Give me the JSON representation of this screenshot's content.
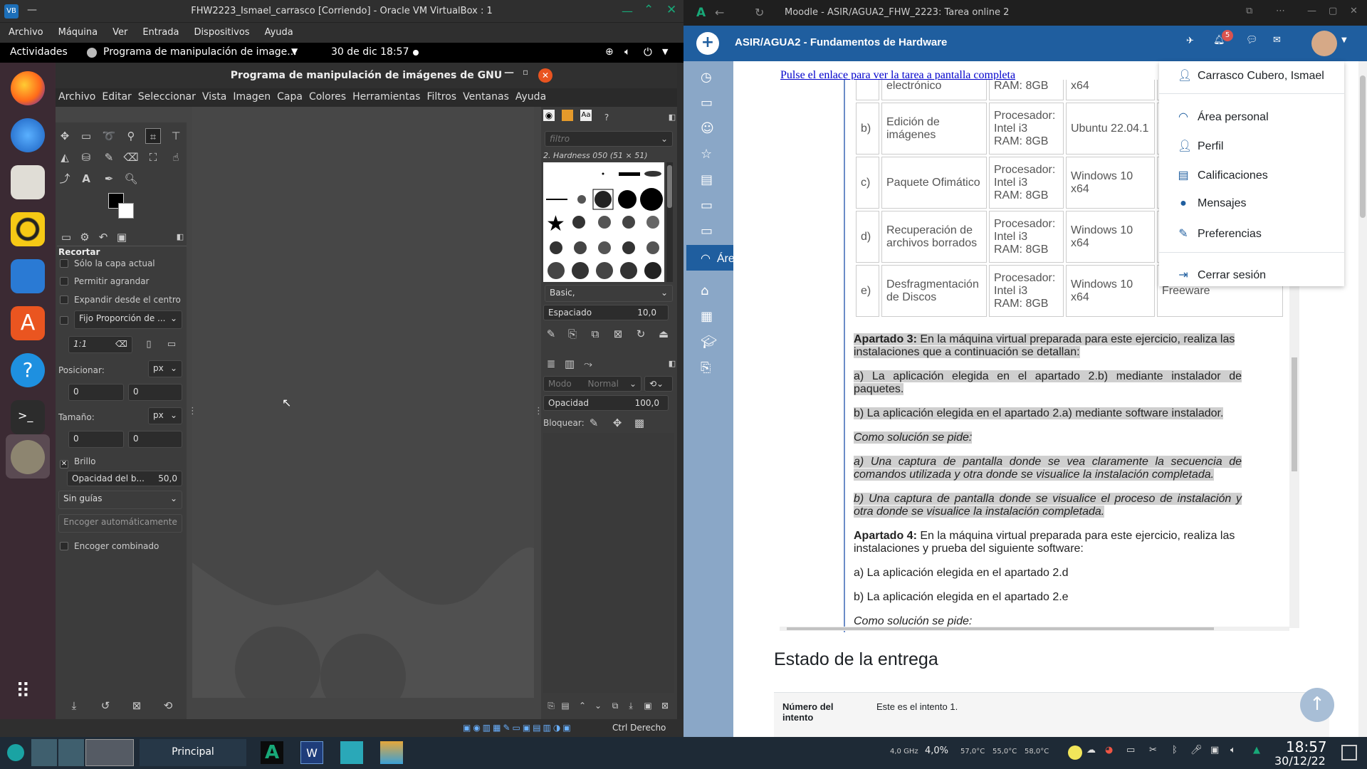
{
  "vbox": {
    "title": "FHW2223_Ismael_carrasco [Corriendo] - Oracle VM VirtualBox : 1",
    "menu": [
      "Archivo",
      "Máquina",
      "Ver",
      "Entrada",
      "Dispositivos",
      "Ayuda"
    ],
    "status_host_key": "Ctrl Derecho"
  },
  "gnome": {
    "activities": "Actividades",
    "app_name": "Programa de manipulación de image...",
    "clock": "30 de dic  18:57"
  },
  "gimp": {
    "title": "Programa de manipulación de imágenes de GNU",
    "menu": [
      "Archivo",
      "Editar",
      "Seleccionar",
      "Vista",
      "Imagen",
      "Capa",
      "Colores",
      "Herramientas",
      "Filtros",
      "Ventanas",
      "Ayuda"
    ],
    "tool_options": {
      "title": "Recortar",
      "current_layer": "Sólo la capa actual",
      "allow_grow": "Permitir agrandar",
      "expand_center": "Expandir desde el centro",
      "fixed_ratio": "Fijo Proporción de ...",
      "ratio_value": "1:1",
      "position_label": "Posicionar:",
      "position_unit": "px",
      "pos_x": "0",
      "pos_y": "0",
      "size_label": "Tamaño:",
      "size_unit": "px",
      "size_x": "0",
      "size_y": "0",
      "highlight": "Brillo",
      "highlight_opacity_label": "Opacidad del b...",
      "highlight_opacity_value": "50,0",
      "guides": "Sin guías",
      "auto_shrink": "Encoger automáticamente",
      "shrink_merged": "Encoger combinado"
    },
    "brushes": {
      "filter_placeholder": "filtro",
      "brush_name": "2. Hardness 050 (51 × 51)",
      "preset": "Basic,",
      "spacing_label": "Espaciado",
      "spacing_value": "10,0"
    },
    "layers": {
      "mode_label": "Modo",
      "mode_value": "Normal",
      "opacity_label": "Opacidad",
      "opacity_value": "100,0",
      "lock_label": "Bloquear:"
    }
  },
  "browser": {
    "title": "Moodle - ASIR/AGUA2_FHW_2223: Tarea online 2",
    "course": "ASIR/AGUA2 - Fundamentos de Hardware",
    "notif_count": "5",
    "fullscreen_link": "Pulse el enlace para ver la tarea a pantalla completa",
    "active_nav": "Área personal",
    "table_rows": [
      {
        "letter": "",
        "task": "electrónico",
        "hw": "RAM: 8GB",
        "os": "x64",
        "lic": ""
      },
      {
        "letter": "b)",
        "task": "Edición de imágenes",
        "hw": "Procesador: Intel i3 RAM: 8GB",
        "os": "Ubuntu 22.04.1",
        "lic": ""
      },
      {
        "letter": "c)",
        "task": "Paquete Ofimático",
        "hw": "Procesador: Intel i3 RAM: 8GB",
        "os": "Windows 10 x64",
        "lic": ""
      },
      {
        "letter": "d)",
        "task": "Recuperación de archivos borrados",
        "hw": "Procesador: Intel i3 RAM: 8GB",
        "os": "Windows 10 x64",
        "lic": ""
      },
      {
        "letter": "e)",
        "task": "Desfragmentación de Discos",
        "hw": "Procesador: Intel i3 RAM: 8GB",
        "os": "Windows 10 x64",
        "lic": "Freeware"
      }
    ],
    "apartado3_title": "Apartado 3:",
    "apartado3_text": "En la máquina virtual preparada para este ejercicio, realiza las instalaciones que a continuación se detallan:",
    "a3_a": "a) La aplicación elegida en el apartado 2.b) mediante instalador de paquetes.",
    "a3_b": "b) La aplicación elegida en el apartado 2.a) mediante software instalador.",
    "solucion": "Como solución se pide:",
    "a3_sol_a": "a) Una captura de pantalla donde se vea claramente la secuencia de comandos utilizada y otra donde se visualice la instalación completada.",
    "a3_sol_b": "b) Una captura de pantalla donde se visualice el proceso de instalación y otra donde se visualice la instalación completada.",
    "apartado4_title": "Apartado 4:",
    "apartado4_text": "En la máquina virtual preparada para este ejercicio, realiza las instalaciones y prueba del siguiente software:",
    "a4_a": "a) La aplicación elegida en el apartado 2.d",
    "a4_b": "b) La aplicación elegida en el apartado 2.e",
    "a4_sol": "Como solución se pide:",
    "estado_heading": "Estado de la entrega",
    "intento_label": "Número del intento",
    "intento_value": "Este es el intento 1.",
    "user_menu": [
      "Carrasco Cubero, Ismael",
      "Área personal",
      "Perfil",
      "Calificaciones",
      "Mensajes",
      "Preferencias",
      "Cerrar sesión"
    ]
  },
  "taskbar": {
    "task_label": "Principal",
    "cpu_freq": "4,0 GHz",
    "cpu_load": "4,0%",
    "temp1": "57,0°C",
    "temp2": "55,0°C",
    "temp3": "58,0°C",
    "time": "18:57",
    "date": "30/12/22"
  },
  "colors": {
    "moodle_blue": "#1f5e9f",
    "dock": "#3b2a33",
    "gimp_bg": "#454545"
  }
}
